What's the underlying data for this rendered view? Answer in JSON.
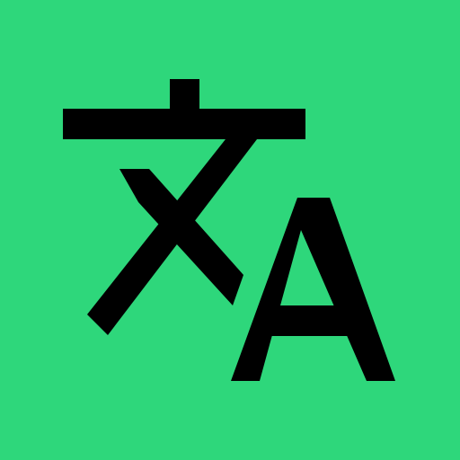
{
  "icon": {
    "name": "translate-icon",
    "background_color": "#2ED77B",
    "glyph_color": "#000000",
    "source_glyph": "文",
    "target_glyph": "A"
  }
}
